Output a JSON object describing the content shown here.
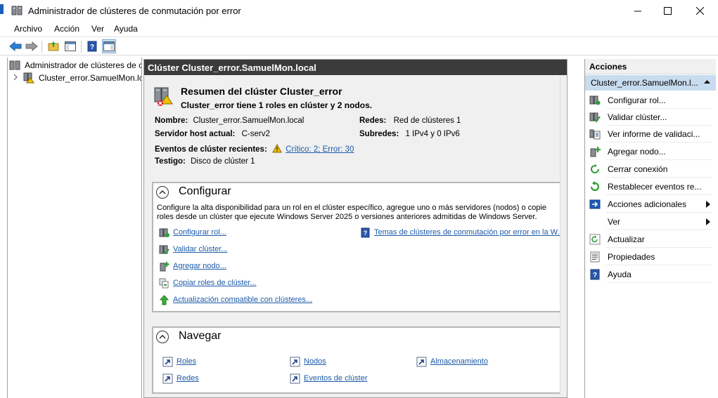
{
  "window": {
    "title": "Administrador de clústeres de conmutación por error"
  },
  "menu": [
    "Archivo",
    "Acción",
    "Ver",
    "Ayuda"
  ],
  "tree": {
    "root": "Administrador de clústeres de c",
    "cluster": "Cluster_error.SamuelMon.lc"
  },
  "center": {
    "header": "Clúster Cluster_error.SamuelMon.local",
    "summary_title": "Resumen del clúster Cluster_error",
    "summary_sub": "Cluster_error tiene 1 roles en clúster y 2 nodos.",
    "info": {
      "nombre_label": "Nombre:",
      "nombre_value": "Cluster_error.SamuelMon.local",
      "host_label": "Servidor host actual:",
      "host_value": "C-serv2",
      "eventos_label": "Eventos de clúster recientes:",
      "eventos_value": "Crítico: 2; Error: 30",
      "testigo_label": "Testigo:",
      "testigo_value": "Disco de clúster 1",
      "redes_label": "Redes:",
      "redes_value": "Red de clústeres 1",
      "subredes_label": "Subredes:",
      "subredes_value": "1 IPv4 y 0 IPv6"
    },
    "configure": {
      "title": "Configurar",
      "description": "Configure la alta disponibilidad para un rol en el clúster específico, agregue uno o más servidores (nodos) o copie roles desde un clúster que ejecute Windows Server 2025 o versiones anteriores admitidas de Windows Server.",
      "links": [
        "Configurar rol...",
        "Validar clúster...",
        "Agregar nodo...",
        "Copiar roles de clúster...",
        "Actualización compatible con clústeres..."
      ],
      "topics": "Temas de clústeres de conmutación por error en la W..."
    },
    "navigate": {
      "title": "Navegar",
      "links": [
        "Roles",
        "Nodos",
        "Almacenamiento",
        "Redes",
        "Eventos de clúster"
      ]
    }
  },
  "actions": {
    "header": "Acciones",
    "subheader": "Cluster_error.SamuelMon.l...",
    "items": [
      "Configurar rol...",
      "Validar clúster...",
      "Ver informe de validaci...",
      "Agregar nodo...",
      "Cerrar conexión",
      "Restablecer eventos re...",
      "Acciones adicionales",
      "Ver",
      "Actualizar",
      "Propiedades",
      "Ayuda"
    ]
  }
}
